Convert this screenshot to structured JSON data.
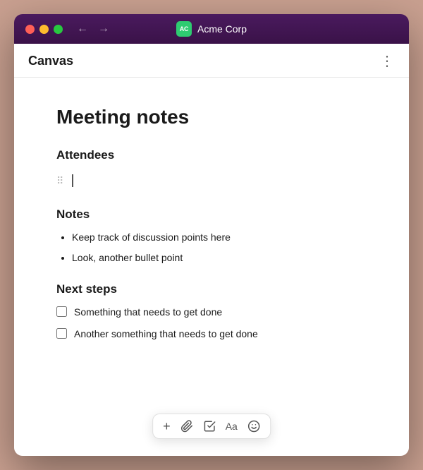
{
  "titlebar": {
    "app_name": "Acme Corp",
    "avatar_initials": "AC",
    "back_arrow": "←",
    "forward_arrow": "→"
  },
  "toolbar": {
    "canvas_label": "Canvas",
    "more_icon": "⋮"
  },
  "document": {
    "title": "Meeting notes",
    "sections": [
      {
        "heading": "Attendees",
        "type": "attendees"
      },
      {
        "heading": "Notes",
        "type": "bullets",
        "items": [
          "Keep track of discussion points here",
          "Look, another bullet point"
        ]
      },
      {
        "heading": "Next steps",
        "type": "checkboxes",
        "items": [
          "Something that needs to get done",
          "Another something that needs to get done"
        ]
      }
    ]
  },
  "floating_toolbar": {
    "buttons": [
      {
        "name": "plus",
        "symbol": "+",
        "label": "Add"
      },
      {
        "name": "attachment",
        "symbol": "⌀",
        "label": "Attach"
      },
      {
        "name": "checkbox",
        "symbol": "☑",
        "label": "Checkbox"
      },
      {
        "name": "font",
        "symbol": "Aa",
        "label": "Font"
      },
      {
        "name": "emoji",
        "symbol": "☺",
        "label": "Emoji"
      }
    ]
  }
}
